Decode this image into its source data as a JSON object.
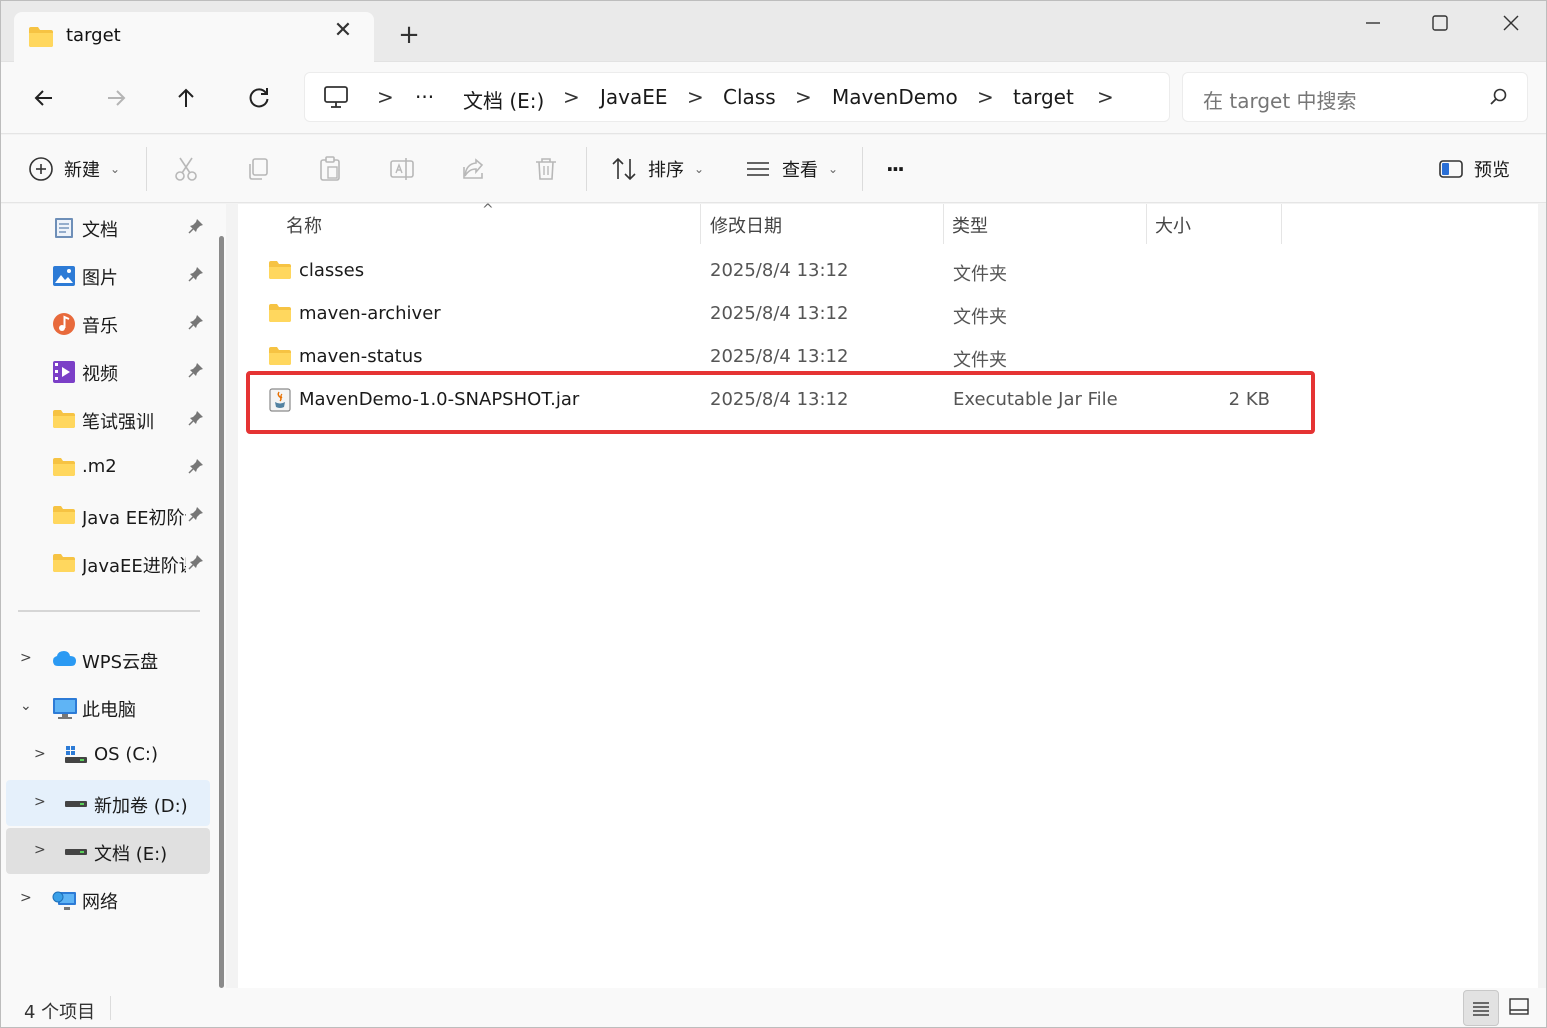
{
  "window": {
    "tab_title": "target",
    "new_tab_symbol": "+",
    "close_symbol": "✕"
  },
  "address": {
    "breadcrumbs": [
      "文档 (E:)",
      "JavaEE",
      "Class",
      "MavenDemo",
      "target"
    ],
    "overflow": "···",
    "search_placeholder": "在 target 中搜索"
  },
  "toolbar": {
    "new_label": "新建",
    "sort_label": "排序",
    "view_label": "查看",
    "more_label": "···",
    "preview_label": "预览"
  },
  "sidebar": {
    "quick_access": [
      {
        "label": "文档",
        "icon": "documents-icon"
      },
      {
        "label": "图片",
        "icon": "pictures-icon"
      },
      {
        "label": "音乐",
        "icon": "music-icon"
      },
      {
        "label": "视频",
        "icon": "videos-icon"
      },
      {
        "label": "笔试强训",
        "icon": "folder-icon"
      },
      {
        "label": ".m2",
        "icon": "folder-icon"
      },
      {
        "label": "Java EE初阶课",
        "icon": "folder-icon"
      },
      {
        "label": "JavaEE进阶课",
        "icon": "folder-icon"
      }
    ],
    "tree": {
      "wps": "WPS云盘",
      "this_pc": "此电脑",
      "drive_c": "OS (C:)",
      "drive_d": "新加卷 (D:)",
      "drive_e": "文档 (E:)",
      "network": "网络"
    }
  },
  "file_list": {
    "columns": {
      "name": "名称",
      "modified": "修改日期",
      "type": "类型",
      "size": "大小"
    },
    "rows": [
      {
        "name": "classes",
        "modified": "2025/8/4 13:12",
        "type": "文件夹",
        "size": "",
        "icon": "folder-icon"
      },
      {
        "name": "maven-archiver",
        "modified": "2025/8/4 13:12",
        "type": "文件夹",
        "size": "",
        "icon": "folder-icon"
      },
      {
        "name": "maven-status",
        "modified": "2025/8/4 13:12",
        "type": "文件夹",
        "size": "",
        "icon": "folder-icon"
      },
      {
        "name": "MavenDemo-1.0-SNAPSHOT.jar",
        "modified": "2025/8/4 13:12",
        "type": "Executable Jar File",
        "size": "2 KB",
        "icon": "jar-file-icon"
      }
    ]
  },
  "status": {
    "item_count": "4 个项目"
  },
  "colors": {
    "highlight": "#e53333",
    "folder": "#f6c343",
    "hover": "#e5f0fb",
    "selected": "#e0e0e0"
  }
}
